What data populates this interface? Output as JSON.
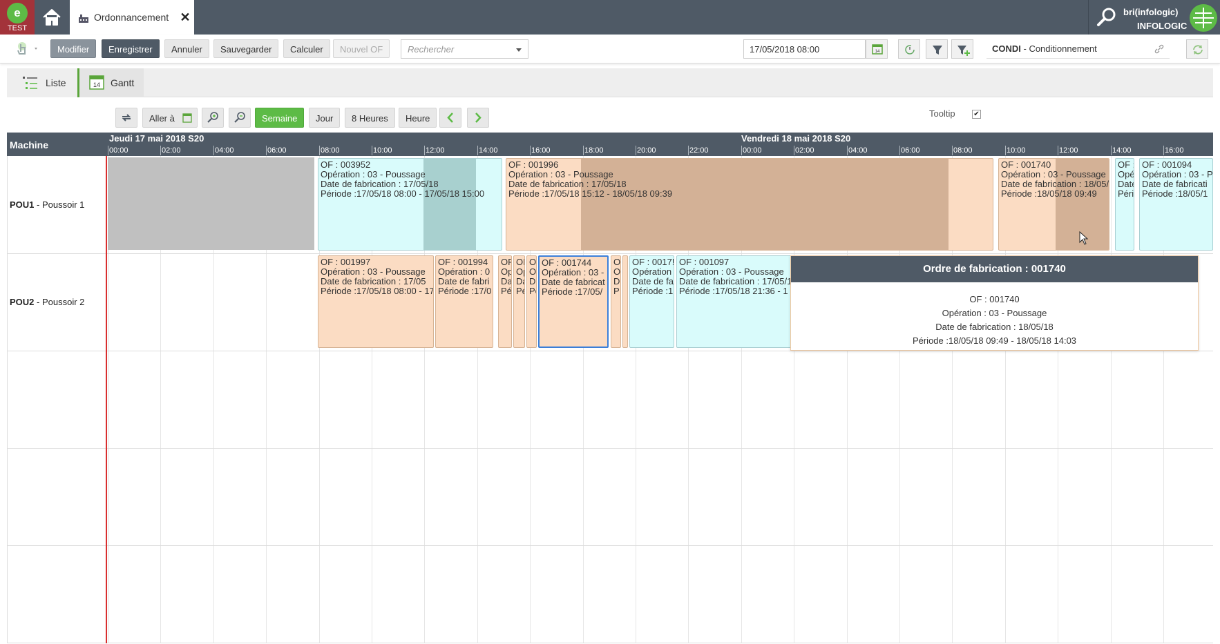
{
  "app": {
    "env_label": "TEST",
    "tab_title": "Ordonnancement",
    "user": "bri(infologic)",
    "org": "INFOLOGIC"
  },
  "toolbar": {
    "modifier": "Modifier",
    "enregistrer": "Enregistrer",
    "annuler": "Annuler",
    "sauvegarder": "Sauvegarder",
    "calculer": "Calculer",
    "nouvel_of": "Nouvel OF",
    "search_placeholder": "Rechercher",
    "date_value": "17/05/2018 08:00",
    "condi_code": "CONDI",
    "condi_label": " - Conditionnement"
  },
  "views": {
    "liste": "Liste",
    "gantt": "Gantt",
    "gantt_icon_day": "14"
  },
  "gantt_controls": {
    "aller_a": "Aller à",
    "semaine": "Semaine",
    "jour": "Jour",
    "huit_heures": "8 Heures",
    "heure": "Heure",
    "tooltip": "Tooltip",
    "tooltip_checked": "✔"
  },
  "gantt": {
    "machine_header": "Machine",
    "days": [
      {
        "label": "Jeudi 17 mai 2018 S20"
      },
      {
        "label": "Vendredi 18 mai 2018 S20"
      }
    ],
    "hours": [
      "00:00",
      "02:00",
      "04:00",
      "06:00",
      "08:00",
      "10:00",
      "12:00",
      "14:00",
      "16:00",
      "18:00",
      "20:00",
      "22:00",
      "00:00",
      "02:00",
      "04:00",
      "06:00",
      "08:00",
      "10:00",
      "12:00",
      "14:00",
      "16:00"
    ],
    "rows": [
      {
        "code": "POU1",
        "name": " - Poussoir 1"
      },
      {
        "code": "POU2",
        "name": " - Poussoir 2"
      }
    ],
    "tasks_row1": [
      {
        "lines": [
          "OF : 003952",
          "Opération : 03 - Poussage",
          "Date de fabrication : 17/05/18",
          "Période :17/05/18 08:00  - 17/05/18 15:00"
        ]
      },
      {
        "lines": [
          "OF : 001996",
          "Opération : 03 - Poussage",
          "Date de fabrication : 17/05/18",
          "Période :17/05/18 15:12  - 18/05/18 09:39"
        ]
      },
      {
        "lines": [
          "OF : 001740",
          "Opération : 03 - Poussage",
          "Date de fabrication : 18/05/18",
          "Période :18/05/18 09:49"
        ]
      },
      {
        "lines": [
          "OF :",
          "Opé",
          "Date",
          "Péri"
        ]
      },
      {
        "lines": [
          "OF : 001094",
          "Opération : 03 - P",
          "Date de fabricati",
          "Période :18/05/1"
        ]
      }
    ],
    "tasks_row2": [
      {
        "lines": [
          "OF : 001997",
          "Opération : 03 - Poussage",
          "Date de fabrication : 17/05",
          "Période :17/05/18 08:00  - 17"
        ]
      },
      {
        "lines": [
          "OF : 001994",
          "Opération : 0",
          "Date de fabri",
          "Période :17/0"
        ]
      },
      {
        "lines": [
          "OF",
          "Op",
          "Da",
          "Pé"
        ]
      },
      {
        "lines": [
          "OI",
          "Op",
          "Da",
          "Pé"
        ]
      },
      {
        "lines": [
          "O",
          "O",
          "D",
          "Pé"
        ]
      },
      {
        "lines": [
          "OF : 001744",
          "Opération : 03 -",
          "Date de fabricat",
          "Période :17/05/"
        ]
      },
      {
        "lines": [
          "O",
          "O",
          "D",
          "P"
        ]
      },
      {
        "lines": [
          "",
          "",
          "",
          ""
        ]
      },
      {
        "lines": [
          "OF : 0017!",
          "Opération",
          "Date de fa",
          "Période :1"
        ]
      },
      {
        "lines": [
          "OF : 001097",
          "Opération : 03 - Poussage",
          "Date de fabrication : 17/05/1",
          "Période :17/05/18 21:36  - 1"
        ]
      }
    ]
  },
  "popup": {
    "title": "Ordre de fabrication : 001740",
    "of": "OF : 001740",
    "operation": "Opération : 03 - Poussage",
    "date": "Date de fabrication : 18/05/18",
    "periode": "Période :18/05/18 09:49 - 18/05/18 14:03"
  },
  "colors": {
    "header": "#4f5a66",
    "accent_green": "#5dbb46",
    "test_red": "#a3333a",
    "task_cyan": "#d9fbfb",
    "task_peach": "#fbdcc3",
    "now_line": "#d92e2e"
  }
}
